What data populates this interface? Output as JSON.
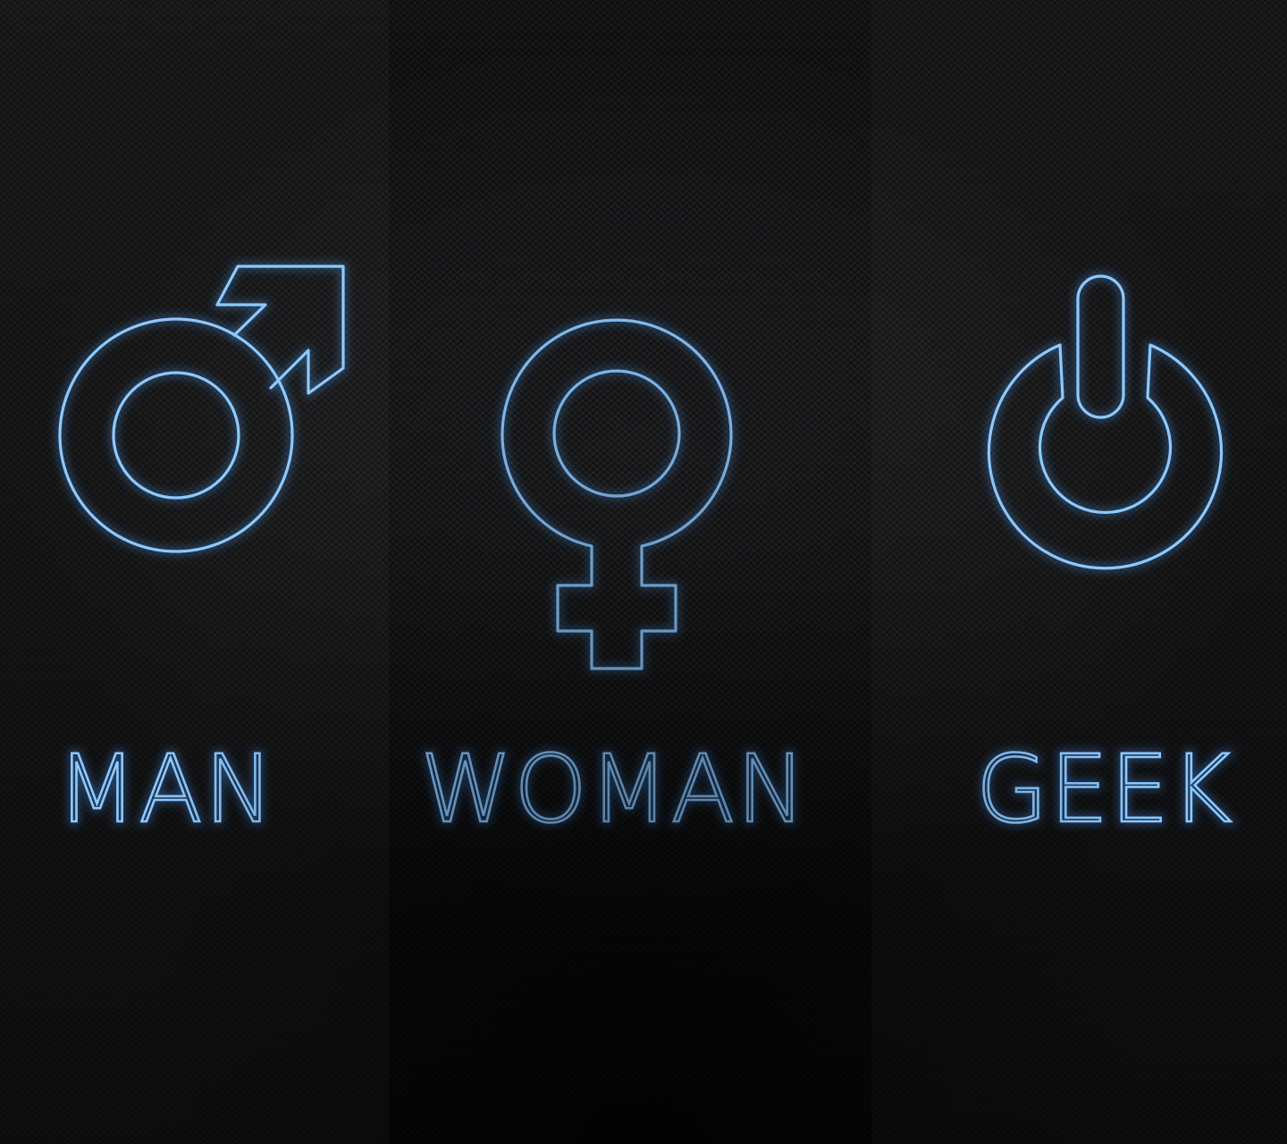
{
  "labels": {
    "man": "MAN",
    "woman": "WOMAN",
    "geek": "GEEK"
  },
  "icons": {
    "man": "male-symbol-icon",
    "woman": "female-symbol-icon",
    "geek": "power-symbol-icon"
  },
  "colors": {
    "neon_blue": "#8cc8ff",
    "neon_glow": "#4aa3ff",
    "background": "#121214"
  }
}
